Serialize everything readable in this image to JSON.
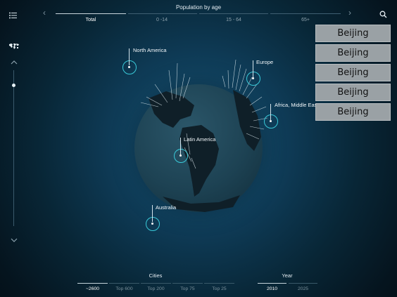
{
  "header": {
    "title": "Population by age",
    "tabs": [
      {
        "label": "Total",
        "active": true
      },
      {
        "label": "0 -14",
        "active": false
      },
      {
        "label": "15 - 64",
        "active": false
      },
      {
        "label": "65+",
        "active": false
      }
    ]
  },
  "globe": {
    "regions": [
      {
        "label": "North America"
      },
      {
        "label": "Europe"
      },
      {
        "label": "Africa, Middle East"
      },
      {
        "label": "Latin America"
      },
      {
        "label": "Australia"
      }
    ]
  },
  "city_overlay": [
    "Beijing",
    "Beijing",
    "Beijing",
    "Beijing",
    "Beijing"
  ],
  "bottom": {
    "cities_title": "Cities",
    "cities_tabs": [
      {
        "label": "~2600",
        "active": true
      },
      {
        "label": "Top 600",
        "active": false
      },
      {
        "label": "Top 200",
        "active": false
      },
      {
        "label": "Top 75",
        "active": false
      },
      {
        "label": "Top 25",
        "active": false
      }
    ],
    "year_title": "Year",
    "year_tabs": [
      {
        "label": "2010",
        "active": true
      },
      {
        "label": "2025",
        "active": false
      }
    ]
  },
  "icons": {
    "menu": "list-menu-icon",
    "search": "search-icon",
    "map": "world-map-icon",
    "prev": "chevron-left-icon",
    "next": "chevron-right-icon",
    "up": "chevron-up-icon",
    "down": "chevron-down-icon"
  },
  "colors": {
    "accent": "#39c9d8",
    "background": "#082636"
  }
}
